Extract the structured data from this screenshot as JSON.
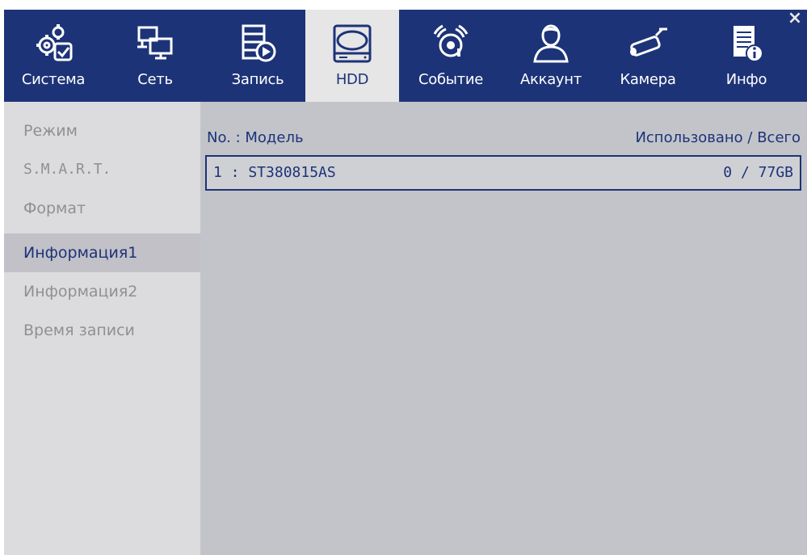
{
  "tabs": [
    {
      "label": "Система",
      "icon": "system-settings-icon"
    },
    {
      "label": "Сеть",
      "icon": "network-icon"
    },
    {
      "label": "Запись",
      "icon": "record-icon"
    },
    {
      "label": "HDD",
      "icon": "hdd-icon",
      "active": true
    },
    {
      "label": "Событие",
      "icon": "event-alarm-icon"
    },
    {
      "label": "Аккаунт",
      "icon": "account-user-icon"
    },
    {
      "label": "Камера",
      "icon": "camera-icon"
    },
    {
      "label": "Инфо",
      "icon": "info-icon"
    }
  ],
  "close_label": "×",
  "sidebar": {
    "items": [
      {
        "label": "Режим"
      },
      {
        "label": "S.M.A.R.T."
      },
      {
        "label": "Формат"
      },
      {
        "label": "Информация1",
        "active": true
      },
      {
        "label": "Информация2"
      },
      {
        "label": "Время записи"
      }
    ]
  },
  "table": {
    "headers": {
      "left": "No. : Модель",
      "right": "Использовано / Всего"
    },
    "rows": [
      {
        "model": "1 : ST380815AS",
        "usage": "0 / 77GB"
      }
    ]
  },
  "colors": {
    "accent": "#1d3378",
    "panel": "#c2c4c9",
    "sidebar": "#dcdcde"
  }
}
